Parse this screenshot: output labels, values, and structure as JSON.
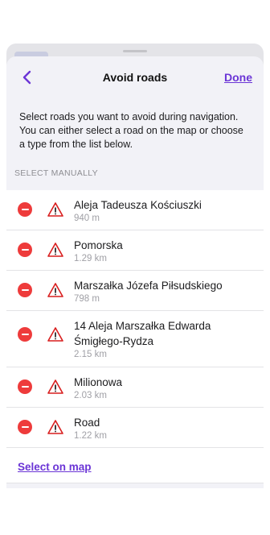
{
  "nav": {
    "title": "Avoid roads",
    "done_label": "Done"
  },
  "description": "Select roads you want to avoid during navigation. You can either select a road on the map or choose a type from the list below.",
  "section_header": "SELECT MANUALLY",
  "roads": [
    {
      "name": "Aleja Tadeusza Kościuszki",
      "distance": "940 m"
    },
    {
      "name": "Pomorska",
      "distance": "1.29 km"
    },
    {
      "name": "Marszałka Józefa Piłsudskiego",
      "distance": "798 m"
    },
    {
      "name": "14 Aleja Marszałka Edwarda Śmigłego-Rydza",
      "distance": "2.15 km"
    },
    {
      "name": "Milionowa",
      "distance": "2.03 km"
    },
    {
      "name": "Road",
      "distance": "1.22 km"
    }
  ],
  "footer": {
    "select_on_map_label": "Select on map"
  },
  "colors": {
    "accent": "#6b35d6",
    "remove": "#ee3b3b",
    "warning": "#d81e1e"
  },
  "icons": {
    "back": "chevron-left-icon",
    "remove": "minus-circle-icon",
    "warning": "warning-triangle-icon"
  }
}
